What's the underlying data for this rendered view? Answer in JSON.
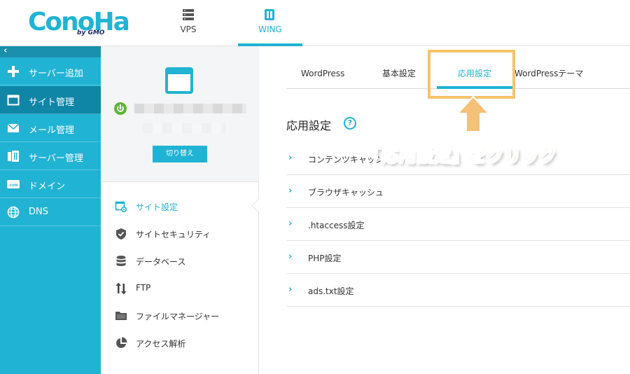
{
  "header": {
    "logo": "ConoHa",
    "logo_sub": "by GMO",
    "tabs": [
      {
        "label": "VPS",
        "icon": "server-icon"
      },
      {
        "label": "WING",
        "icon": "wing-icon"
      }
    ]
  },
  "sidebar": {
    "collapse_label": "‹",
    "items": [
      {
        "label": "サーバー追加",
        "icon": "plus-icon"
      },
      {
        "label": "サイト管理",
        "icon": "window-icon"
      },
      {
        "label": "メール管理",
        "icon": "mail-icon"
      },
      {
        "label": "サーバー管理",
        "icon": "server-manage-icon"
      },
      {
        "label": "ドメイン",
        "icon": "domain-icon"
      },
      {
        "label": "DNS",
        "icon": "globe-icon"
      }
    ]
  },
  "site_card": {
    "switch_label": "切り替え"
  },
  "site_menu": {
    "items": [
      {
        "label": "サイト設定",
        "icon": "site-settings-icon"
      },
      {
        "label": "サイトセキュリティ",
        "icon": "shield-icon"
      },
      {
        "label": "データベース",
        "icon": "database-icon"
      },
      {
        "label": "FTP",
        "icon": "transfer-icon"
      },
      {
        "label": "ファイルマネージャー",
        "icon": "folder-icon"
      },
      {
        "label": "アクセス解析",
        "icon": "pie-chart-icon"
      }
    ]
  },
  "content": {
    "tabs": [
      "WordPress",
      "基本設定",
      "応用設定",
      "WordPressテーマ"
    ],
    "section_title": "応用設定",
    "help_label": "?",
    "accordion": [
      "コンテンツキャッシュ",
      "ブラウザキャッシュ",
      ".htaccess設定",
      "PHP設定",
      "ads.txt設定"
    ],
    "chevron": "›",
    "annotation": "「応用設定」をクリック"
  },
  "colors": {
    "accent": "#21b3d4",
    "sidebar_active": "#0f86a6",
    "highlight": "#f7c36b",
    "annotation": "#f5b049",
    "power": "#5cb531"
  }
}
